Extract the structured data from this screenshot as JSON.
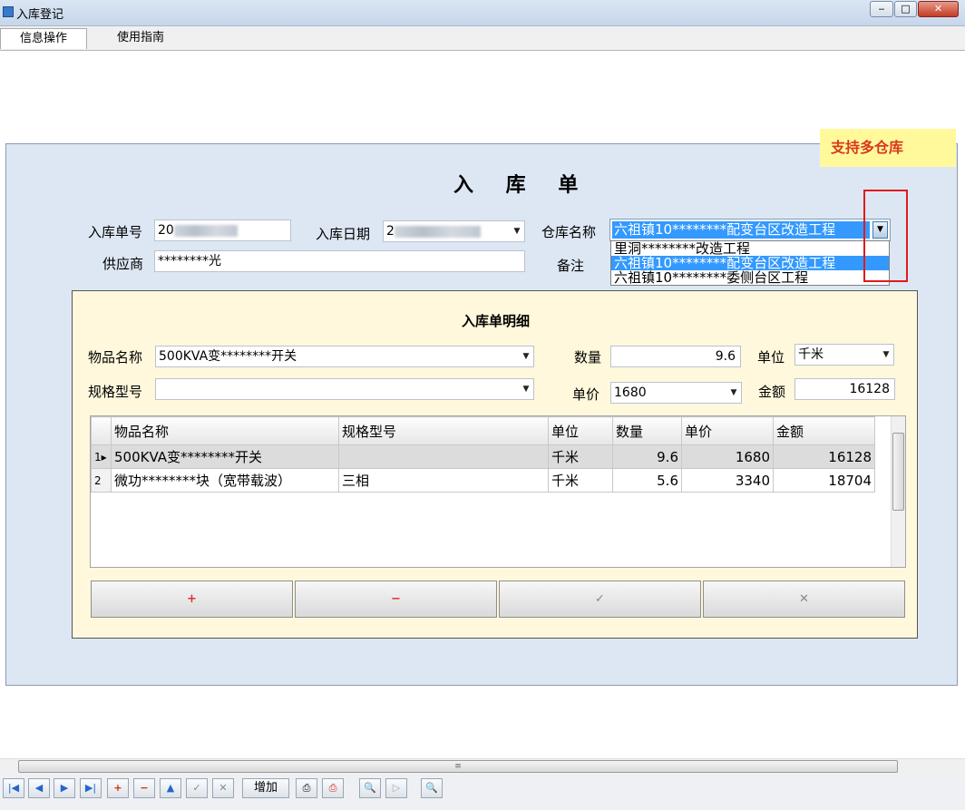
{
  "window": {
    "title": "入库登记",
    "minimize": "‒",
    "maximize": "□",
    "close": "✕"
  },
  "menu": {
    "tabs": [
      "信息操作",
      "使用指南"
    ]
  },
  "annotation": "支持多仓库",
  "form": {
    "heading": "入 库 单",
    "order_no_label": "入库单号",
    "order_no_value": "20",
    "date_label": "入库日期",
    "date_value": "2",
    "warehouse_label": "仓库名称",
    "warehouse_selected": "六祖镇10********配变台区改造工程",
    "warehouse_options": [
      "里洞********改造工程",
      "六祖镇10********配变台区改造工程",
      "六祖镇10********委侧台区工程"
    ],
    "supplier_label": "供应商",
    "supplier_value": "********光",
    "remark_label": "备注"
  },
  "detail": {
    "title": "入库单明细",
    "item_name_label": "物品名称",
    "item_name_value": "500KVA变********开关",
    "qty_label": "数量",
    "qty_value": "9.6",
    "unit_label": "单位",
    "unit_value": "千米",
    "spec_label": "规格型号",
    "spec_value": "",
    "price_label": "单价",
    "price_value": "1680",
    "amount_label": "金额",
    "amount_value": "16128",
    "columns": [
      "物品名称",
      "规格型号",
      "单位",
      "数量",
      "单价",
      "金额"
    ],
    "rows": [
      {
        "idx": "1",
        "marker": "▸",
        "name": "500KVA变********开关",
        "spec": "",
        "unit": "千米",
        "qty": "9.6",
        "price": "1680",
        "amount": "16128"
      },
      {
        "idx": "2",
        "marker": "",
        "name": "微功********块（宽带载波）",
        "spec": "三相",
        "unit": "千米",
        "qty": "5.6",
        "price": "3340",
        "amount": "18704"
      }
    ],
    "buttons": {
      "add": "+",
      "remove": "−",
      "confirm": "✓",
      "cancel": "✕"
    }
  },
  "toolbar": {
    "first": "|◀",
    "prev": "◀",
    "next": "▶",
    "last": "▶|",
    "add_icon": "+",
    "remove_icon": "−",
    "up_icon": "▲",
    "ok_icon": "✓",
    "cancel_icon": "✕",
    "add_text": "增加",
    "print": "⎙",
    "print_export": "⎙",
    "preview": "🔍",
    "play": "▷",
    "search": "🔍"
  },
  "colors": {
    "form_bg": "#dde7f4",
    "detail_bg": "#fff8dc",
    "selection": "#3399ff",
    "annotation_bg": "#fff99c",
    "annotation_text": "#d9381e",
    "highlight_box": "#e01b1b"
  }
}
